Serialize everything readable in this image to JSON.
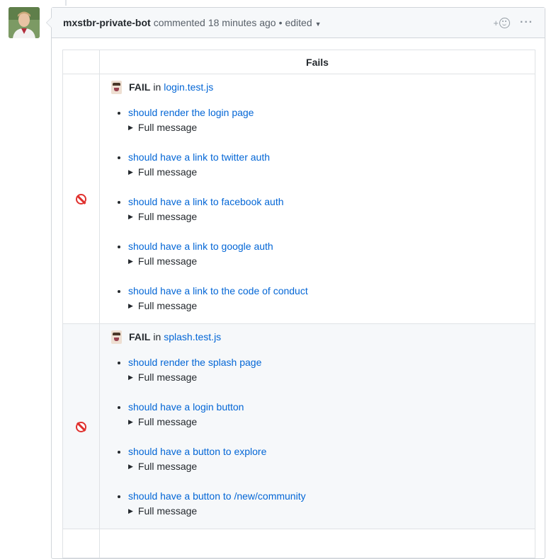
{
  "comment": {
    "author": "mxstbr-private-bot",
    "action": "commented",
    "time": "18 minutes ago",
    "separator": "•",
    "edited": "edited",
    "reaction_plus": "+"
  },
  "table": {
    "header": "Fails",
    "groups": [
      {
        "fail_label": "FAIL",
        "in_text": "in",
        "file": "login.test.js",
        "tests": [
          {
            "name": "should render the login page",
            "detail": "Full message"
          },
          {
            "name": "should have a link to twitter auth",
            "detail": "Full message"
          },
          {
            "name": "should have a link to facebook auth",
            "detail": "Full message"
          },
          {
            "name": "should have a link to google auth",
            "detail": "Full message"
          },
          {
            "name": "should have a link to the code of conduct",
            "detail": "Full message"
          }
        ]
      },
      {
        "fail_label": "FAIL",
        "in_text": "in",
        "file": "splash.test.js",
        "tests": [
          {
            "name": "should render the splash page",
            "detail": "Full message"
          },
          {
            "name": "should have a login button",
            "detail": "Full message"
          },
          {
            "name": "should have a button to explore",
            "detail": "Full message"
          },
          {
            "name": "should have a button to /new/community",
            "detail": "Full message"
          }
        ]
      }
    ]
  },
  "icons": {
    "status": "prohibited-icon",
    "jest": "jest-icon",
    "disclosure": "triangle-right-icon",
    "colors": {
      "link": "#0366d6",
      "fail": "#e0312e",
      "header_bg": "#f6f8fa",
      "border": "#d1d5da"
    }
  }
}
